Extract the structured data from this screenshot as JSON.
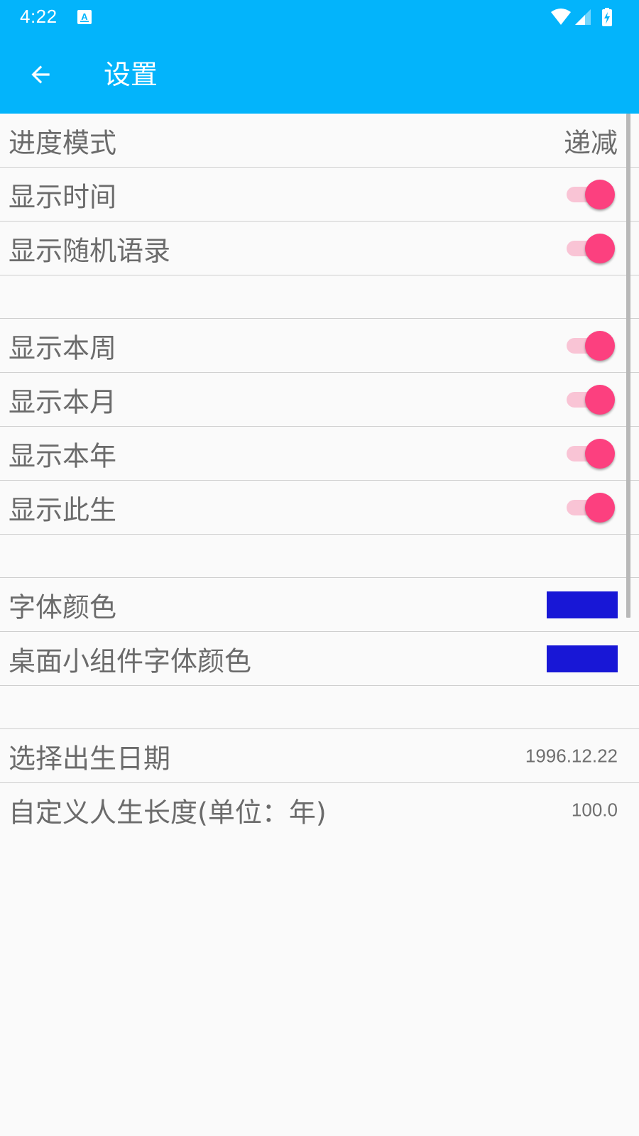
{
  "status_bar": {
    "time": "4:22",
    "color": "#03b4fb",
    "icons": [
      "notification-a-icon",
      "wifi-icon",
      "cell-signal-icon",
      "battery-icon"
    ]
  },
  "app_bar": {
    "title": "设置",
    "back_icon": "arrow-back-icon",
    "color": "#03b4fb"
  },
  "settings": {
    "progress_mode": {
      "label": "进度模式",
      "value": "递减"
    },
    "show_time": {
      "label": "显示时间",
      "checked": true
    },
    "show_quote": {
      "label": "显示随机语录",
      "checked": true
    },
    "show_week": {
      "label": "显示本周",
      "checked": true
    },
    "show_month": {
      "label": "显示本月",
      "checked": true
    },
    "show_year": {
      "label": "显示本年",
      "checked": true
    },
    "show_life": {
      "label": "显示此生",
      "checked": true
    },
    "font_color": {
      "label": "字体颜色",
      "color": "#1817d6"
    },
    "widget_font_color": {
      "label": "桌面小组件字体颜色",
      "color": "#1817d6"
    },
    "birth_date": {
      "label": "选择出生日期",
      "value": "1996.12.22"
    },
    "life_length": {
      "label": "自定义人生长度(单位：年)",
      "value": "100.0"
    }
  },
  "colors": {
    "toggle_on_thumb": "#fc407f",
    "toggle_on_track": "#f9c4d5",
    "text": "#6b6b6b",
    "background": "#fafafa"
  }
}
